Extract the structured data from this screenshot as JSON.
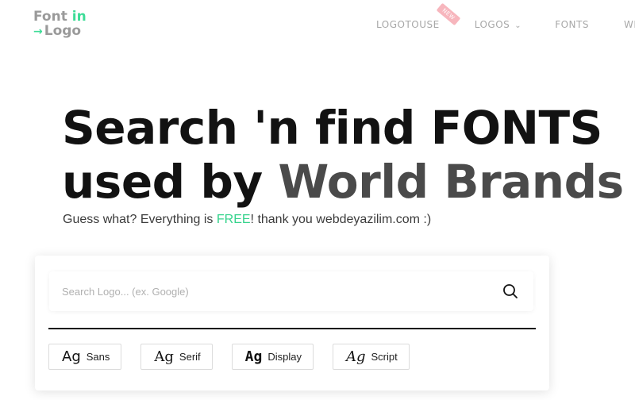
{
  "header": {
    "logo": {
      "word1": "Font",
      "word2": "in",
      "word3": "Logo"
    },
    "nav": [
      {
        "label": "LOGOTOUSE",
        "badge": "NEW"
      },
      {
        "label": "LOGOS"
      },
      {
        "label": "FONTS"
      },
      {
        "label": "WE"
      }
    ]
  },
  "hero": {
    "line1": "Search 'n find FONTS",
    "line2_a": "used by ",
    "line2_b": "World Brands"
  },
  "subtitle": {
    "before": "Guess what? Everything is ",
    "free": "FREE",
    "after": "! thank you webdeyazilim.com :)"
  },
  "search": {
    "placeholder": "Search Logo... (ex. Google)",
    "value": ""
  },
  "filters": [
    {
      "ag": "Ag",
      "label": "Sans"
    },
    {
      "ag": "Ag",
      "label": "Serif"
    },
    {
      "ag": "Ag",
      "label": "Display"
    },
    {
      "ag": "Ag",
      "label": "Script"
    }
  ],
  "colors": {
    "accent": "#3ddc97",
    "badge": "#f7b6bd",
    "heading": "#121212",
    "heading_grey": "#4a4a4a"
  }
}
